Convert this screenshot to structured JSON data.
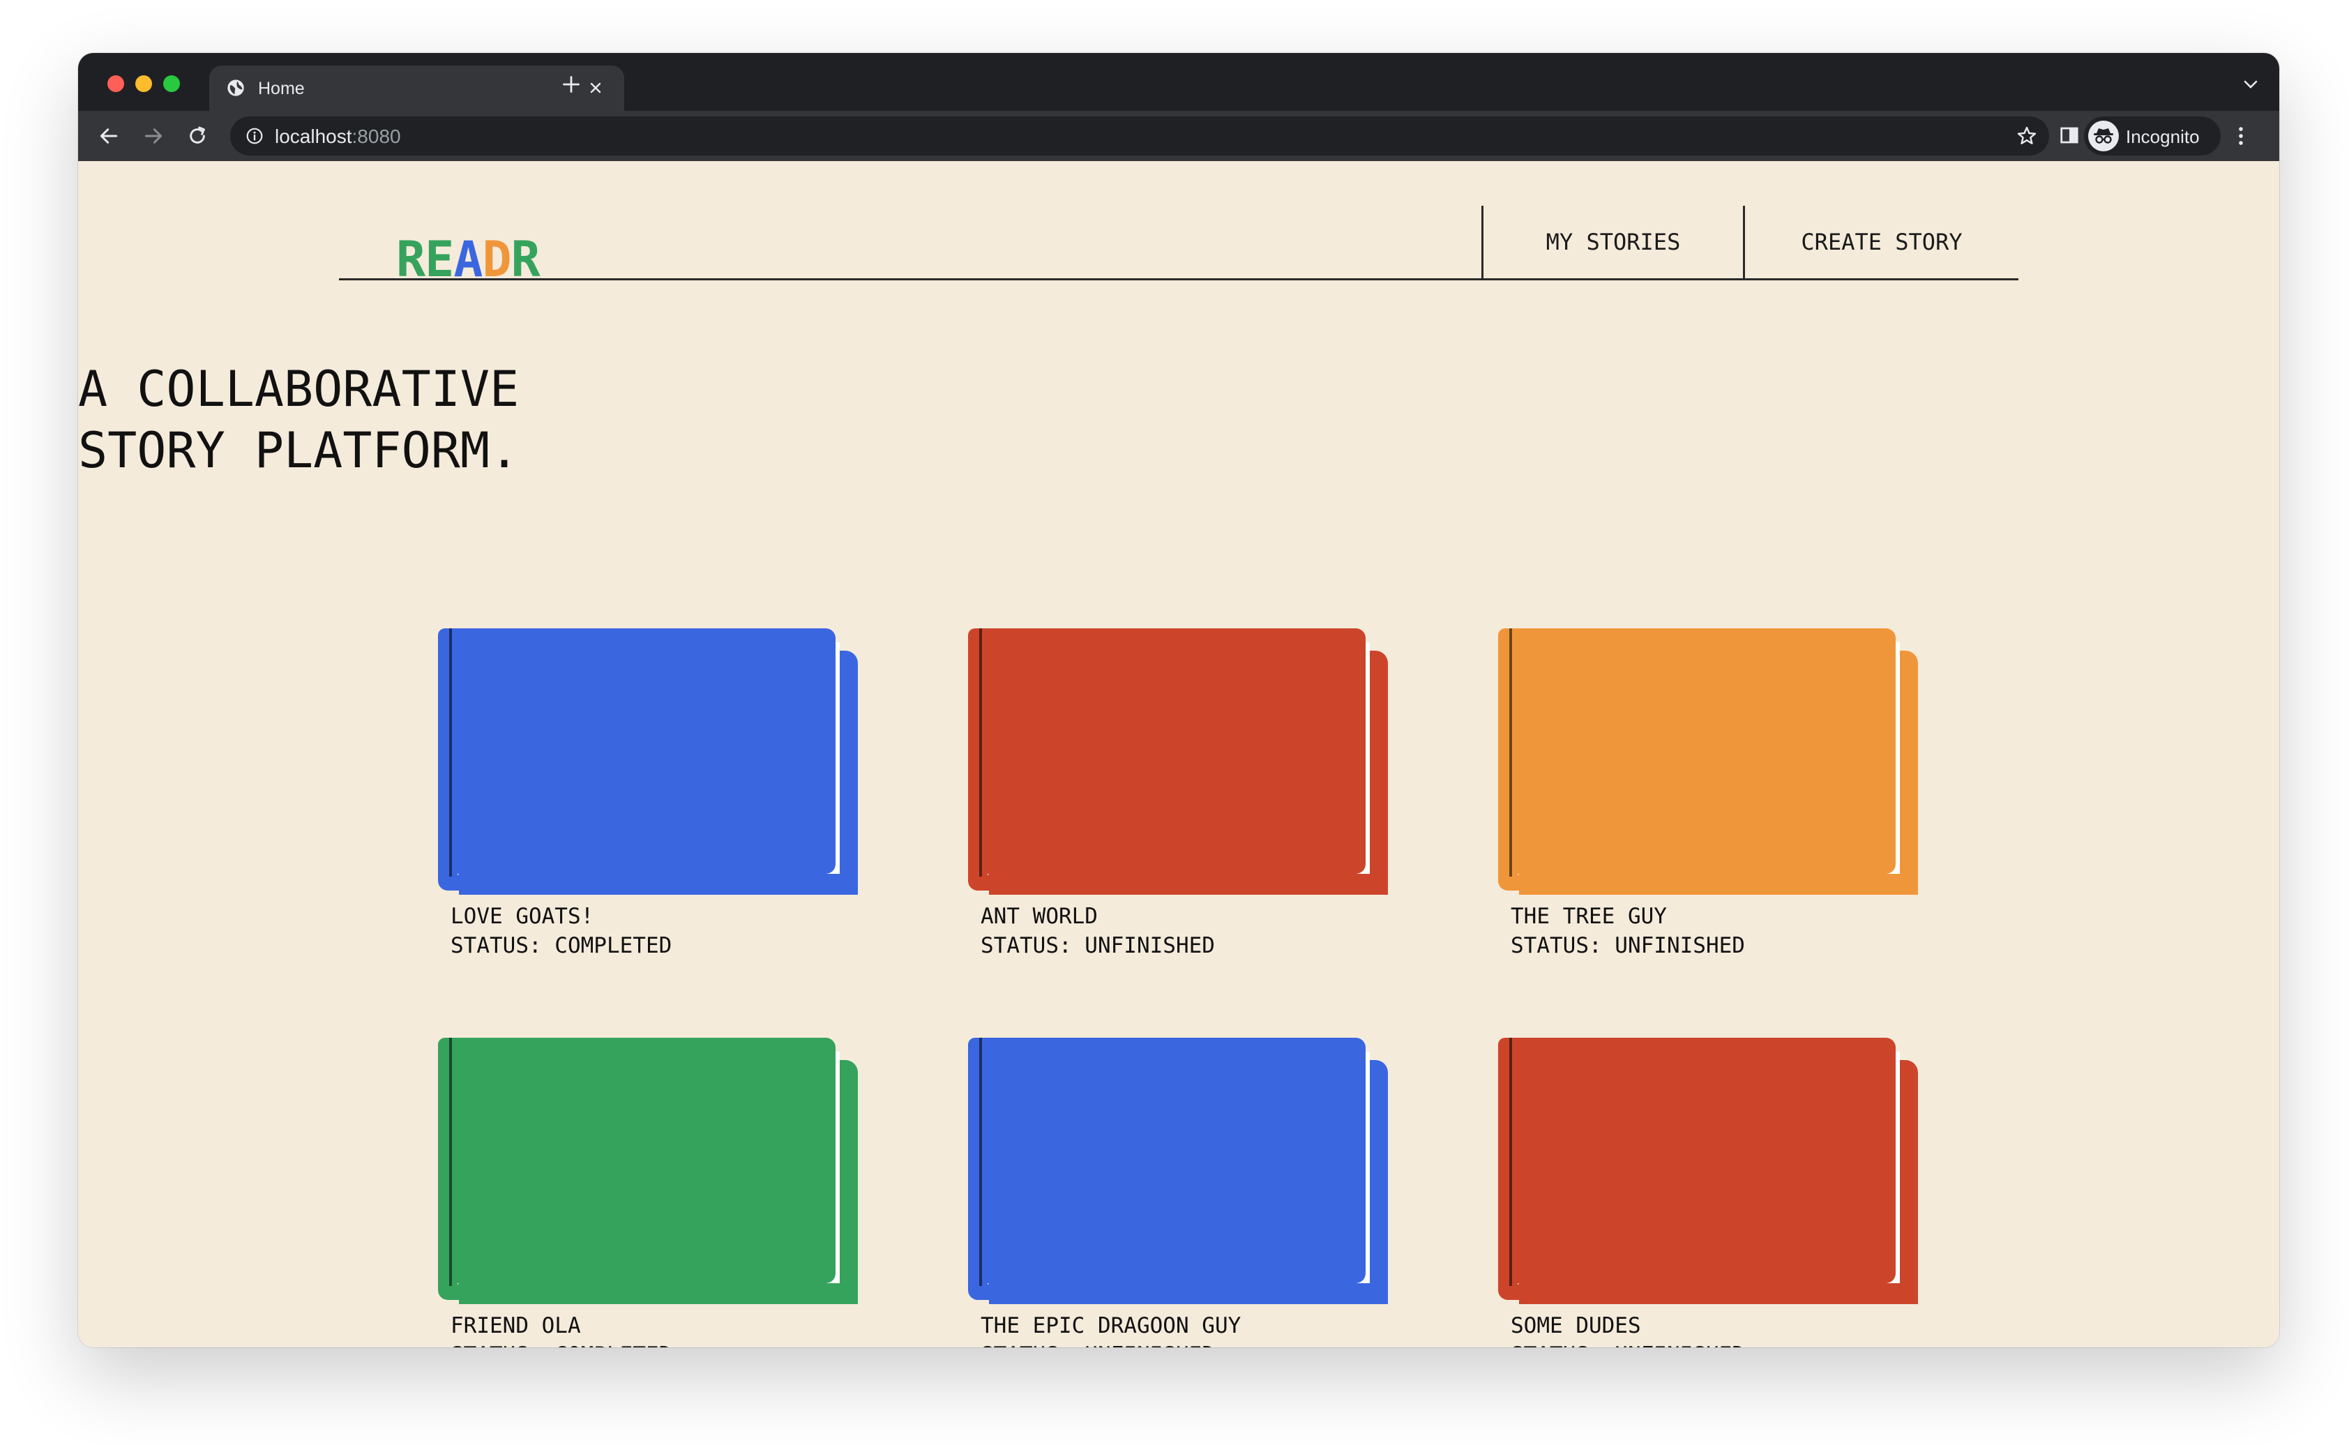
{
  "browser": {
    "tab_title": "Home",
    "url_host": "localhost",
    "url_port": ":8080",
    "profile_label": "Incognito"
  },
  "site": {
    "logo_letters": [
      {
        "char": "R",
        "color": "#36a35c"
      },
      {
        "char": "E",
        "color": "#36a35c"
      },
      {
        "char": "A",
        "color": "#3a66e0"
      },
      {
        "char": "D",
        "color": "#f0963a"
      },
      {
        "char": "R",
        "color": "#36a35c"
      }
    ],
    "nav": {
      "my_stories": "MY STORIES",
      "create_story": "CREATE STORY"
    },
    "hero_lines": [
      "A COLLABORATIVE",
      "STORY PLATFORM."
    ]
  },
  "stories": [
    {
      "title": "LOVE GOATS!",
      "status": "STATUS: COMPLETED",
      "color": "#3a66e0"
    },
    {
      "title": "ANT WORLD",
      "status": "STATUS: UNFINISHED",
      "color": "#cc452b"
    },
    {
      "title": "THE TREE GUY",
      "status": "STATUS: UNFINISHED",
      "color": "#f0963a"
    },
    {
      "title": "FRIEND OLA",
      "status": "STATUS: COMPLETED",
      "color": "#36a35c"
    },
    {
      "title": "THE EPIC DRAGOON GUY",
      "status": "STATUS: UNFINISHED",
      "color": "#3a66e0"
    },
    {
      "title": "SOME DUDES",
      "status": "STATUS: UNFINISHED",
      "color": "#cc452b"
    }
  ]
}
